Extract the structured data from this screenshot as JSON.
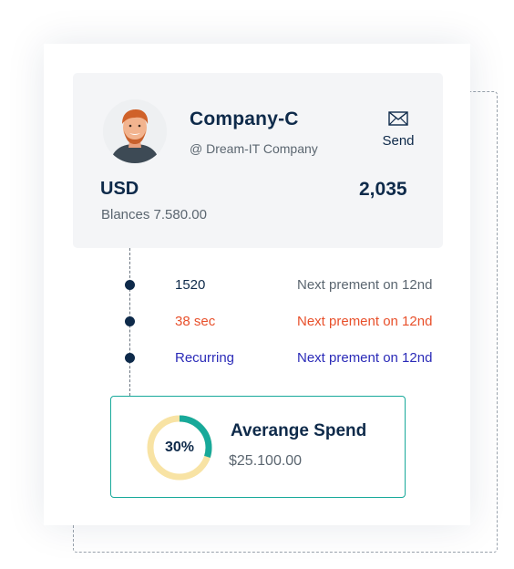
{
  "profile": {
    "company_name": "Company-C",
    "handle": "@ Dream-IT Company",
    "send_label": "Send",
    "send_icon": "envelope-icon",
    "avatar": "avatar-photo"
  },
  "account": {
    "currency": "USD",
    "amount": "2,035",
    "balance_text": "Blances 7.580.00"
  },
  "schedule": [
    {
      "label": "1520",
      "note": "Next prement on 12nd",
      "label_color": "#0e2a4a",
      "note_color": "#5b6670"
    },
    {
      "label": "38 sec",
      "note": "Next prement on 12nd",
      "label_color": "#e8502b",
      "note_color": "#e8502b"
    },
    {
      "label": "Recurring",
      "note": "Next prement on 12nd",
      "label_color": "#2b2bb8",
      "note_color": "#2b2bb8"
    }
  ],
  "spend": {
    "title": "Averange Spend",
    "value": "$25.100.00",
    "percent_label": "30%",
    "percent": 30,
    "ring_fill_color": "#18a99a",
    "ring_track_color": "#f8e3a4"
  },
  "colors": {
    "primary": "#0e2a4a",
    "accent_teal": "#18a99a",
    "panel_bg": "#f4f5f7"
  }
}
